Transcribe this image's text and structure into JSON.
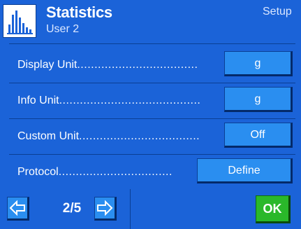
{
  "header": {
    "icon": "statistics-bar-chart-icon",
    "title": "Statistics",
    "subtitle": "User 2",
    "right_label": "Setup"
  },
  "settings": [
    {
      "label": "Display Unit",
      "dots": "...................................",
      "value": "g"
    },
    {
      "label": "Info Unit",
      "dots": ".........................................",
      "value": "g"
    },
    {
      "label": "Custom Unit",
      "dots": "...................................",
      "value": "Off"
    },
    {
      "label": "Protocol",
      "dots": ".................................",
      "value": "Define"
    }
  ],
  "footer": {
    "prev_icon": "arrow-left-icon",
    "next_icon": "arrow-right-icon",
    "page_indicator": "2/5",
    "ok_label": "OK"
  },
  "colors": {
    "background": "#1b63d8",
    "button": "#2a8ef0",
    "ok_button": "#2ab82a",
    "text": "#ffffff"
  }
}
